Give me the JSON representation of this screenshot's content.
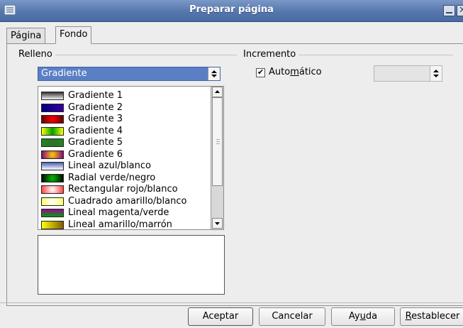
{
  "window": {
    "title": "Preparar página"
  },
  "tabs": [
    {
      "label": "Página",
      "active": false
    },
    {
      "label": "Fondo",
      "active": true
    }
  ],
  "relleno": {
    "group_label": "Relleno",
    "selected": "Gradiente",
    "items": [
      {
        "label": "Gradiente 1",
        "gradient": "linear-gradient(#333333,#f2f2f2)"
      },
      {
        "label": "Gradiente 2",
        "gradient": "linear-gradient(90deg,#000080,#3a00a0)"
      },
      {
        "label": "Gradiente 3",
        "gradient": "radial-gradient(circle,#ff0000,#600000)"
      },
      {
        "label": "Gradiente 4",
        "gradient": "linear-gradient(90deg,#ffff00,#00a000,#ffff00)"
      },
      {
        "label": "Gradiente 5",
        "gradient": "radial-gradient(circle,#2f6f2f,#1a8a1a)"
      },
      {
        "label": "Gradiente 6",
        "gradient": "radial-gradient(circle,#ffd000,#800080)"
      },
      {
        "label": "Lineal azul/blanco",
        "gradient": "linear-gradient(#4a5fb5,#ffffff)"
      },
      {
        "label": "Radial verde/negro",
        "gradient": "radial-gradient(circle,#00c000,#000000)"
      },
      {
        "label": "Rectangular rojo/blanco",
        "gradient": "radial-gradient(circle,#ffffff,#ff4040)"
      },
      {
        "label": "Cuadrado amarillo/blanco",
        "gradient": "radial-gradient(circle,#ffffff,#ffff60)"
      },
      {
        "label": "Lineal magenta/verde",
        "gradient": "linear-gradient(#a000a0,#00a000)"
      },
      {
        "label": "Lineal amarillo/marrón",
        "gradient": "linear-gradient(90deg,#ffff00,#806000)"
      }
    ]
  },
  "incremento": {
    "group_label": "Incremento",
    "auto_label_before": "Auto",
    "auto_label_accel": "m",
    "auto_label_after": "ático",
    "auto_checked": true,
    "check_glyph": "✔",
    "spin_value": ""
  },
  "buttons": {
    "ok": "Aceptar",
    "cancel": "Cancelar",
    "help_before": "Ay",
    "help_accel": "u",
    "help_after": "da",
    "reset_accel": "R",
    "reset_after": "establecer"
  }
}
